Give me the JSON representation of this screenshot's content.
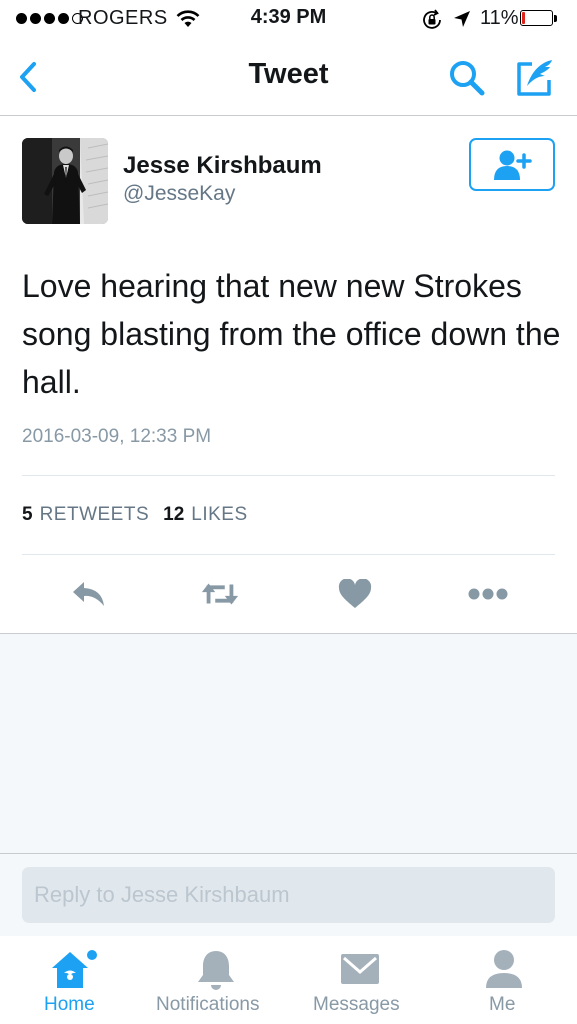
{
  "status_bar": {
    "carrier": "ROGERS",
    "time": "4:39 PM",
    "battery_percent": "11%",
    "battery_level": 0.11,
    "battery_color": "#e0231b",
    "icons": [
      "signal-dots",
      "wifi-icon",
      "orientation-lock-icon",
      "location-arrow-icon",
      "battery-icon"
    ]
  },
  "nav": {
    "title": "Tweet",
    "icons": [
      "back-chevron-icon",
      "search-icon",
      "compose-tweet-icon"
    ]
  },
  "tweet": {
    "author_name": "Jesse Kirshbaum",
    "author_handle": "@JesseKay",
    "text": "Love hearing that new new Strokes song blasting from the office down the hall.",
    "timestamp": "2016-03-09, 12:33 PM",
    "retweets_count": "5",
    "retweets_label": "RETWEETS",
    "likes_count": "12",
    "likes_label": "LIKES"
  },
  "actions": {
    "icons": [
      "reply-icon",
      "retweet-icon",
      "like-heart-icon",
      "more-dots-icon"
    ]
  },
  "reply": {
    "placeholder": "Reply to Jesse Kirshbaum"
  },
  "tabs": [
    {
      "label": "Home",
      "icon": "home-icon",
      "active": true
    },
    {
      "label": "Notifications",
      "icon": "bell-icon",
      "active": false
    },
    {
      "label": "Messages",
      "icon": "envelope-icon",
      "active": false
    },
    {
      "label": "Me",
      "icon": "person-icon",
      "active": false
    }
  ],
  "colors": {
    "accent": "#1da1f2",
    "text": "#14171a",
    "secondary_text": "#657786",
    "icon_gray": "#8899a6",
    "background_gray": "#f5f8fa"
  }
}
